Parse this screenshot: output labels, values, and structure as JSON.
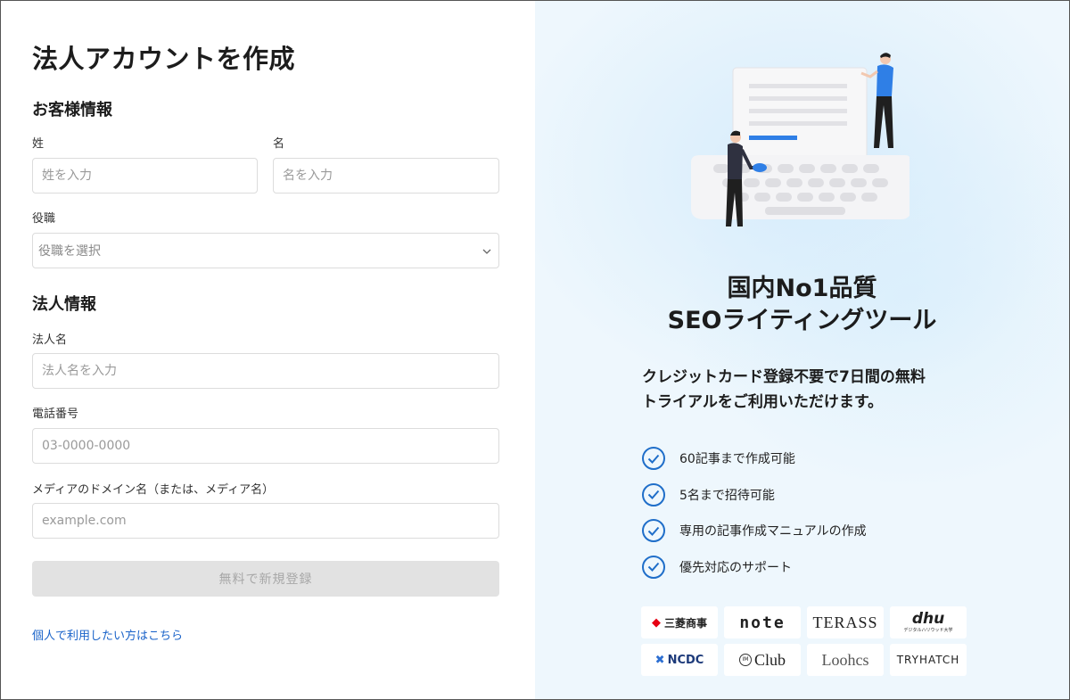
{
  "form": {
    "title": "法人アカウントを作成",
    "customer_section": "お客様情報",
    "last_name": {
      "label": "姓",
      "placeholder": "姓を入力"
    },
    "first_name": {
      "label": "名",
      "placeholder": "名を入力"
    },
    "position": {
      "label": "役職",
      "placeholder": "役職を選択"
    },
    "company_section": "法人情報",
    "company_name": {
      "label": "法人名",
      "placeholder": "法人名を入力"
    },
    "phone": {
      "label": "電話番号",
      "placeholder": "03-0000-0000"
    },
    "media_domain": {
      "label": "メディアのドメイン名（または、メディア名）",
      "placeholder": "example.com"
    },
    "submit_label": "無料で新規登録",
    "personal_link": "個人で利用したい方はこちら"
  },
  "promo": {
    "title_line1": "国内No1品質",
    "title_line2": "SEOライティングツール",
    "desc_line1": "クレジットカード登録不要で7日間の無料",
    "desc_line2": "トライアルをご利用いただけます。",
    "features": [
      "60記事まで作成可能",
      "5名まで招待可能",
      "専用の記事作成マニュアルの作成",
      "優先対応のサポート"
    ],
    "logos": {
      "mitsubishi": "三菱商事",
      "note": "note",
      "terass": "TERASS",
      "dhu": "dhu",
      "dhu_sub": "デジタルハリウッド大学",
      "ncdc": "NCDC",
      "club": "Club",
      "club_mark": "IM",
      "loohcs": "Loohcs",
      "tryhatch": "TRYHATCH"
    }
  },
  "colors": {
    "accent": "#1f6ec9",
    "link": "#1a63c9",
    "panel_bg": "#eef7fd",
    "button_disabled": "#e2e2e2"
  }
}
